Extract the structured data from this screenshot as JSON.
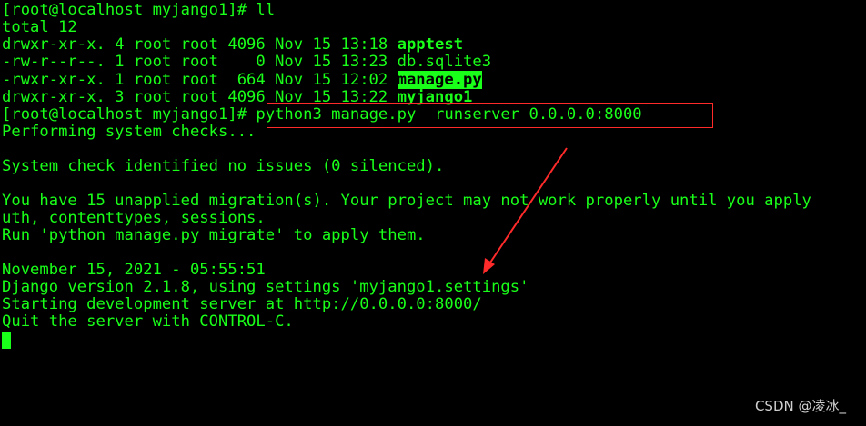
{
  "terminal": {
    "lines": [
      "[root@localhost myjango1]# ll",
      "total 12",
      "drwxr-xr-x. 4 root root 4096 Nov 15 13:18 ",
      "-rw-r--r--. 1 root root    0 Nov 15 13:23 db.sqlite3",
      "-rwxr-xr-x. 1 root root  664 Nov 15 12:02 ",
      "drwxr-xr-x. 3 root root 4096 Nov 15 13:22 ",
      "[root@localhost myjango1]# ",
      "Performing system checks...",
      "",
      "System check identified no issues (0 silenced).",
      "",
      "You have 15 unapplied migration(s). Your project may not work properly until you apply",
      "uth, contenttypes, sessions.",
      "Run 'python manage.py migrate' to apply them.",
      "",
      "November 15, 2021 - 05:55:51",
      "Django version 2.1.8, using settings 'myjango1.settings'",
      "Starting development server at http://0.0.0.0:8000/",
      "Quit the server with CONTROL-C."
    ],
    "listing": {
      "dir1": "apptest",
      "file_exec": "manage.py",
      "dir2": "myjango1"
    },
    "command": "python3 manage.py  runserver 0.0.0.0:8000"
  },
  "watermark": "CSDN @凌冰_",
  "colors": {
    "background": "#000000",
    "text": "#19ff19",
    "annotation": "#ff2a2a"
  }
}
